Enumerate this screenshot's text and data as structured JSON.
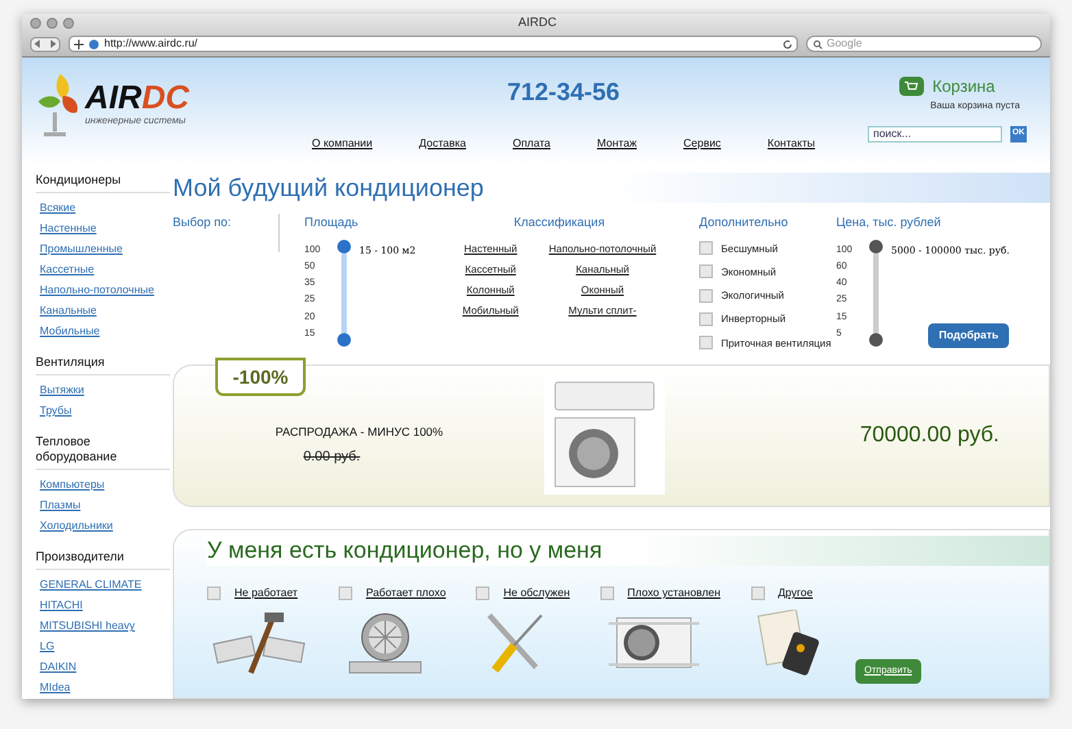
{
  "window": {
    "title": "AIRDC",
    "url": "http://www.airdc.ru/",
    "search_placeholder": "Google"
  },
  "header": {
    "logo": {
      "brand_a": "AIR",
      "brand_b": "DC",
      "tagline": "инженерные системы"
    },
    "phone": "712-34-56",
    "cart": {
      "label": "Корзина",
      "status": "Ваша корзина пуста"
    },
    "nav": [
      "О компании",
      "Доставка",
      "Оплата",
      "Монтаж",
      "Сервис",
      "Контакты"
    ],
    "search": {
      "placeholder": "поиск...",
      "button": "OK"
    }
  },
  "sidebar": [
    {
      "heading": "Кондиционеры",
      "items": [
        "Всякие",
        "Настенные",
        "Промышленные",
        "Кассетные",
        "Напольно-потолочные",
        "Канальные",
        "Мобильные"
      ]
    },
    {
      "heading": "Вентиляция",
      "items": [
        "Вытяжки",
        "Трубы"
      ]
    },
    {
      "heading": "Тепловое оборудование",
      "items": [
        "Компьютеры",
        "Плазмы",
        "Холодильники"
      ]
    },
    {
      "heading": "Производители",
      "items": [
        "GENERAL CLIMATE",
        "HITACHI",
        "MITSUBISHI heavy",
        "LG",
        "DAIKIN",
        "MIdea"
      ]
    }
  ],
  "filter": {
    "title": "Мой будущий кондиционер",
    "by": "Выбор по:",
    "area": {
      "heading": "Площадь",
      "ticks": [
        "100",
        "50",
        "35",
        "25",
        "20",
        "15"
      ],
      "level": 1,
      "reading": "15 - 100 м2"
    },
    "classification": {
      "heading": "Классификация",
      "left": [
        "Настенный",
        "Кассетный",
        "Колонный",
        "Мобильный"
      ],
      "right": [
        "Напольно-потолочный",
        "Канальный",
        "Оконный",
        "Мульти сплит-"
      ]
    },
    "extra": {
      "heading": "Дополнительно",
      "options": [
        {
          "label": "Бесшумный",
          "checked": false
        },
        {
          "label": "Экономный",
          "checked": false
        },
        {
          "label": "Экологичный",
          "checked": false
        },
        {
          "label": "Инверторный",
          "checked": false
        },
        {
          "label": "Приточная вентиляция",
          "checked": false
        }
      ]
    },
    "price": {
      "heading": "Цена, тыс. рублей",
      "ticks": [
        "100",
        "60",
        "40",
        "25",
        "15",
        "5"
      ],
      "level": 1,
      "reading": "5000 - 100000 тыс. руб."
    },
    "button": "Подобрать"
  },
  "promo": {
    "badge": "-100%",
    "title": "РАСПРОДАЖА - МИНУС 100%",
    "old_price": "0.00 руб.",
    "price": "70000.00 руб."
  },
  "problems": {
    "title": "У меня есть кондиционер, но у меня",
    "options": [
      {
        "label": "Не работает",
        "checked": false
      },
      {
        "label": "Работает плохо",
        "checked": false
      },
      {
        "label": "Не обслужен",
        "checked": false
      },
      {
        "label": "Плохо установлен",
        "checked": false
      },
      {
        "label": "Другое",
        "checked": false
      }
    ],
    "button": "Отправить"
  }
}
